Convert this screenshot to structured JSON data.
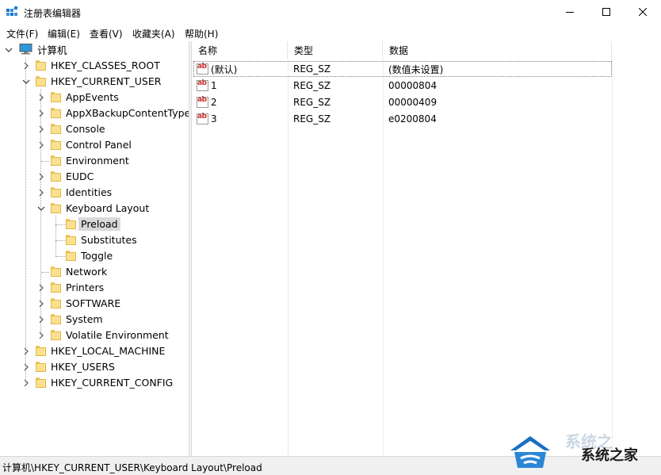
{
  "window": {
    "title": "注册表编辑器",
    "minimize_icon": "minimize-icon",
    "maximize_icon": "maximize-icon",
    "close_icon": "close-icon"
  },
  "menu": {
    "items": [
      "文件(F)",
      "编辑(E)",
      "查看(V)",
      "收藏夹(A)",
      "帮助(H)"
    ]
  },
  "tree": {
    "root": "计算机",
    "hives": {
      "classes_root": "HKEY_CLASSES_ROOT",
      "current_user": "HKEY_CURRENT_USER",
      "local_machine": "HKEY_LOCAL_MACHINE",
      "users": "HKEY_USERS",
      "current_config": "HKEY_CURRENT_CONFIG"
    },
    "current_user_children": [
      "AppEvents",
      "AppXBackupContentType",
      "Console",
      "Control Panel",
      "Environment",
      "EUDC",
      "Identities",
      "Keyboard Layout",
      "Network",
      "Printers",
      "SOFTWARE",
      "System",
      "Volatile Environment"
    ],
    "keyboard_layout_children": [
      "Preload",
      "Substitutes",
      "Toggle"
    ],
    "selected": "Preload"
  },
  "list": {
    "columns": [
      "名称",
      "类型",
      "数据"
    ],
    "rows": [
      {
        "name": "(默认)",
        "type": "REG_SZ",
        "data": "(数值未设置)"
      },
      {
        "name": "1",
        "type": "REG_SZ",
        "data": "00000804"
      },
      {
        "name": "2",
        "type": "REG_SZ",
        "data": "00000409"
      },
      {
        "name": "3",
        "type": "REG_SZ",
        "data": "e0200804"
      }
    ]
  },
  "status": {
    "path": "计算机\\HKEY_CURRENT_USER\\Keyboard Layout\\Preload"
  },
  "watermark": {
    "text": "系统之家"
  }
}
